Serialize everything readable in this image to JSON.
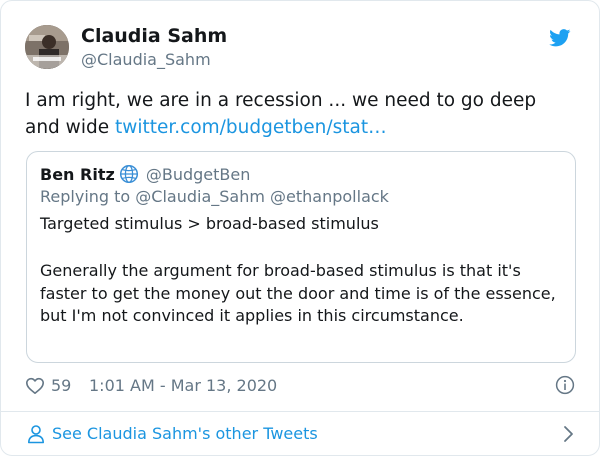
{
  "author": {
    "name": "Claudia Sahm",
    "handle": "@Claudia_Sahm"
  },
  "tweet": {
    "text": "I am right, we are in a recession ... we need to go deep and wide ",
    "link": "twitter.com/budgetben/stat…"
  },
  "quoted": {
    "name": "Ben Ritz",
    "handle": "@BudgetBen",
    "reply_to": "Replying to @Claudia_Sahm @ethanpollack",
    "line1": "Targeted stimulus > broad-based stimulus",
    "paragraph": "Generally the argument for broad-based stimulus is that it's faster to get the money out the door and time is of the essence, but I'm not convinced it applies in this circumstance."
  },
  "meta": {
    "likes": "59",
    "timestamp": "1:01 AM - Mar 13, 2020"
  },
  "footer": {
    "label": "See Claudia Sahm's other Tweets"
  },
  "icons": {
    "bird": "twitter-bird-icon",
    "globe": "globe-icon",
    "heart": "heart-icon",
    "info": "info-icon",
    "person": "person-icon",
    "chevron": "chevron-right-icon"
  },
  "colors": {
    "brand_blue": "#1da1f2",
    "link_blue": "#1b95e0",
    "secondary_text": "#657786",
    "border": "#e1e8ed"
  }
}
